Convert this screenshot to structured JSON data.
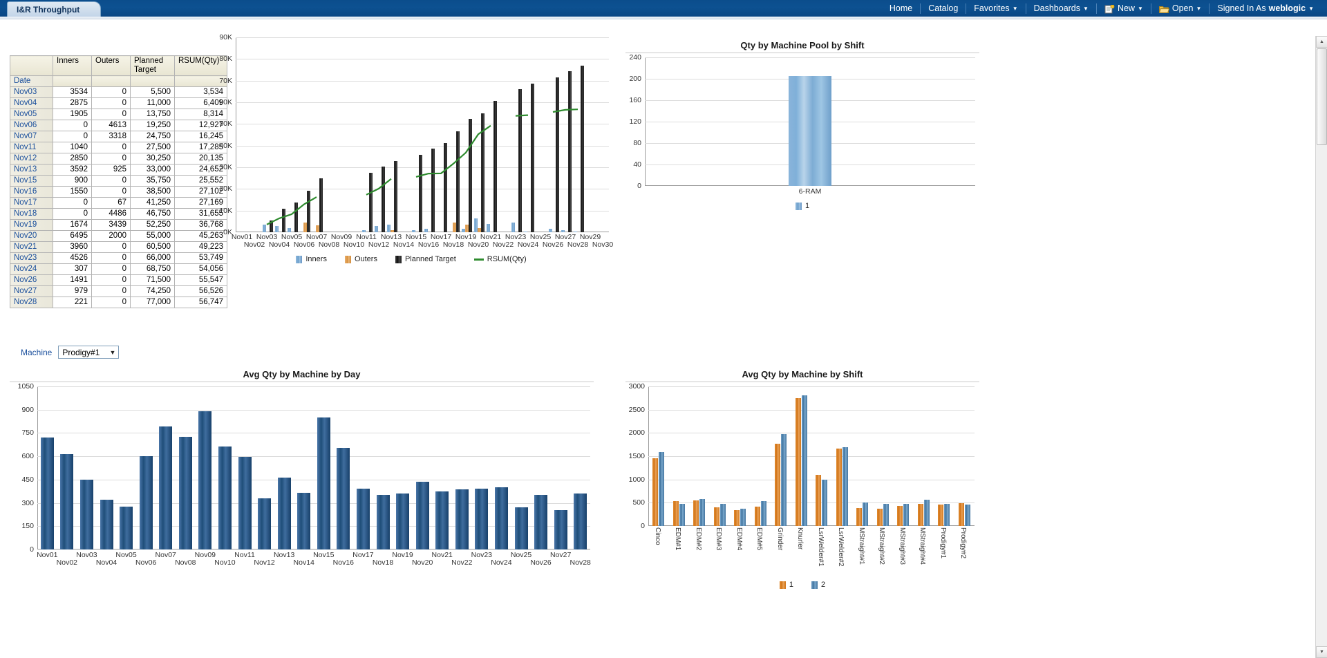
{
  "window": {
    "tab_label": "I&R Throughput"
  },
  "nav": {
    "items": [
      {
        "label": "Home",
        "icon": null,
        "caret": false
      },
      {
        "label": "Catalog",
        "icon": null,
        "caret": false
      },
      {
        "label": "Favorites",
        "icon": null,
        "caret": true
      },
      {
        "label": "Dashboards",
        "icon": null,
        "caret": true
      },
      {
        "label": "New",
        "icon": "new-page-icon",
        "caret": true
      },
      {
        "label": "Open",
        "icon": "folder-open-icon",
        "caret": true
      }
    ],
    "signed_in_label": "Signed In As",
    "user": "weblogic",
    "user_caret": true
  },
  "table": {
    "columns": [
      "",
      "Inners",
      "Outers",
      "Planned Target",
      "RSUM(Qty)"
    ],
    "group_label": "Date",
    "rows": [
      {
        "date": "Nov03",
        "inners": "3534",
        "outers": "0",
        "planned": "5,500",
        "rsum": "3,534"
      },
      {
        "date": "Nov04",
        "inners": "2875",
        "outers": "0",
        "planned": "11,000",
        "rsum": "6,409"
      },
      {
        "date": "Nov05",
        "inners": "1905",
        "outers": "0",
        "planned": "13,750",
        "rsum": "8,314"
      },
      {
        "date": "Nov06",
        "inners": "0",
        "outers": "4613",
        "planned": "19,250",
        "rsum": "12,927"
      },
      {
        "date": "Nov07",
        "inners": "0",
        "outers": "3318",
        "planned": "24,750",
        "rsum": "16,245"
      },
      {
        "date": "Nov11",
        "inners": "1040",
        "outers": "0",
        "planned": "27,500",
        "rsum": "17,285"
      },
      {
        "date": "Nov12",
        "inners": "2850",
        "outers": "0",
        "planned": "30,250",
        "rsum": "20,135"
      },
      {
        "date": "Nov13",
        "inners": "3592",
        "outers": "925",
        "planned": "33,000",
        "rsum": "24,652"
      },
      {
        "date": "Nov15",
        "inners": "900",
        "outers": "0",
        "planned": "35,750",
        "rsum": "25,552"
      },
      {
        "date": "Nov16",
        "inners": "1550",
        "outers": "0",
        "planned": "38,500",
        "rsum": "27,102"
      },
      {
        "date": "Nov17",
        "inners": "0",
        "outers": "67",
        "planned": "41,250",
        "rsum": "27,169"
      },
      {
        "date": "Nov18",
        "inners": "0",
        "outers": "4486",
        "planned": "46,750",
        "rsum": "31,655"
      },
      {
        "date": "Nov19",
        "inners": "1674",
        "outers": "3439",
        "planned": "52,250",
        "rsum": "36,768"
      },
      {
        "date": "Nov20",
        "inners": "6495",
        "outers": "2000",
        "planned": "55,000",
        "rsum": "45,263"
      },
      {
        "date": "Nov21",
        "inners": "3960",
        "outers": "0",
        "planned": "60,500",
        "rsum": "49,223"
      },
      {
        "date": "Nov23",
        "inners": "4526",
        "outers": "0",
        "planned": "66,000",
        "rsum": "53,749"
      },
      {
        "date": "Nov24",
        "inners": "307",
        "outers": "0",
        "planned": "68,750",
        "rsum": "54,056"
      },
      {
        "date": "Nov26",
        "inners": "1491",
        "outers": "0",
        "planned": "71,500",
        "rsum": "55,547"
      },
      {
        "date": "Nov27",
        "inners": "979",
        "outers": "0",
        "planned": "74,250",
        "rsum": "56,526"
      },
      {
        "date": "Nov28",
        "inners": "221",
        "outers": "0",
        "planned": "77,000",
        "rsum": "56,747"
      }
    ]
  },
  "prompt": {
    "label": "Machine",
    "value": "Prodigy#1",
    "options": [
      "Prodigy#1"
    ]
  },
  "chart_data": [
    {
      "id": "throughput",
      "type": "bar",
      "title": "",
      "xlabel": "",
      "ylabel": "",
      "ylim": [
        0,
        90000
      ],
      "ytick_labels": [
        "0K",
        "10K",
        "20K",
        "30K",
        "40K",
        "50K",
        "60K",
        "70K",
        "80K",
        "90K"
      ],
      "yticks": [
        0,
        10000,
        20000,
        30000,
        40000,
        50000,
        60000,
        70000,
        80000,
        90000
      ],
      "grid": true,
      "legend_position": "bottom",
      "categories": [
        "Nov01",
        "Nov02",
        "Nov03",
        "Nov04",
        "Nov05",
        "Nov06",
        "Nov07",
        "Nov08",
        "Nov09",
        "Nov10",
        "Nov11",
        "Nov12",
        "Nov13",
        "Nov14",
        "Nov15",
        "Nov16",
        "Nov17",
        "Nov18",
        "Nov19",
        "Nov20",
        "Nov21",
        "Nov22",
        "Nov23",
        "Nov24",
        "Nov25",
        "Nov26",
        "Nov27",
        "Nov28",
        "Nov29",
        "Nov30"
      ],
      "series": [
        {
          "name": "Inners",
          "color": "#7fb0d9",
          "type": "bar",
          "values": [
            0,
            0,
            3534,
            2875,
            1905,
            0,
            0,
            0,
            0,
            0,
            1040,
            2850,
            3592,
            0,
            900,
            1550,
            0,
            0,
            1674,
            6495,
            3960,
            0,
            4526,
            307,
            0,
            1491,
            979,
            221,
            0,
            0
          ]
        },
        {
          "name": "Outers",
          "color": "#d98c2b",
          "type": "bar",
          "values": [
            0,
            0,
            0,
            0,
            0,
            4613,
            3318,
            0,
            0,
            0,
            0,
            0,
            925,
            0,
            0,
            0,
            67,
            4486,
            3439,
            2000,
            0,
            0,
            0,
            0,
            0,
            0,
            0,
            0,
            0,
            0
          ]
        },
        {
          "name": "Planned Target",
          "color": "#1c1c1c",
          "type": "bar",
          "values": [
            0,
            0,
            5500,
            11000,
            13750,
            19250,
            24750,
            0,
            0,
            0,
            27500,
            30250,
            33000,
            0,
            35750,
            38500,
            41250,
            46750,
            52250,
            55000,
            60500,
            0,
            66000,
            68750,
            0,
            71500,
            74250,
            77000,
            0,
            0
          ]
        },
        {
          "name": "RSUM(Qty)",
          "color": "#2e8b2e",
          "type": "line",
          "values": [
            null,
            null,
            3534,
            6409,
            8314,
            12927,
            16245,
            null,
            null,
            null,
            17285,
            20135,
            24652,
            null,
            25552,
            27102,
            27169,
            31655,
            36768,
            45263,
            49223,
            null,
            53749,
            54056,
            null,
            55547,
            56526,
            56747,
            null,
            null
          ]
        }
      ]
    },
    {
      "id": "qty-machine-pool-shift",
      "type": "bar",
      "title": "Qty by Machine Pool by Shift",
      "xlabel": "",
      "ylabel": "",
      "ylim": [
        0,
        240
      ],
      "yticks": [
        0,
        40,
        80,
        120,
        160,
        200,
        240
      ],
      "grid": true,
      "legend_position": "bottom",
      "categories": [
        "6-RAM"
      ],
      "series": [
        {
          "name": "1",
          "color": "#7fb0d9",
          "values": [
            205
          ]
        }
      ]
    },
    {
      "id": "avg-qty-machine-day",
      "type": "bar",
      "title": "Avg Qty by Machine by Day",
      "xlabel": "",
      "ylabel": "",
      "ylim": [
        0,
        1050
      ],
      "yticks": [
        0,
        150,
        300,
        450,
        600,
        750,
        900,
        1050
      ],
      "grid": true,
      "legend_position": "none",
      "categories": [
        "Nov01",
        "Nov02",
        "Nov03",
        "Nov04",
        "Nov05",
        "Nov06",
        "Nov07",
        "Nov08",
        "Nov09",
        "Nov10",
        "Nov11",
        "Nov12",
        "Nov13",
        "Nov14",
        "Nov15",
        "Nov16",
        "Nov17",
        "Nov18",
        "Nov19",
        "Nov20",
        "Nov21",
        "Nov22",
        "Nov23",
        "Nov24",
        "Nov25",
        "Nov26",
        "Nov27",
        "Nov28"
      ],
      "series": [
        {
          "name": "Avg Qty",
          "color": "#1f4e79",
          "values": [
            720,
            615,
            450,
            320,
            275,
            600,
            790,
            725,
            890,
            665,
            595,
            330,
            465,
            365,
            850,
            655,
            390,
            350,
            360,
            435,
            375,
            385,
            390,
            400,
            270,
            350,
            255,
            360
          ]
        }
      ]
    },
    {
      "id": "avg-qty-machine-shift",
      "type": "bar",
      "title": "Avg Qty by Machine by Shift",
      "xlabel": "",
      "ylabel": "",
      "ylim": [
        0,
        3000
      ],
      "yticks": [
        0,
        500,
        1000,
        1500,
        2000,
        2500,
        3000
      ],
      "grid": true,
      "legend_position": "bottom",
      "categories": [
        "Cinco",
        "EDM#1",
        "EDM#2",
        "EDM#3",
        "EDM#4",
        "EDM#5",
        "Grinder",
        "Knurler",
        "LsrWelder#1",
        "LsrWelder#2",
        "MStraight#1",
        "MStraight#2",
        "MStraight#3",
        "MStraight#4",
        "Prodigy#1",
        "Prodigy#2"
      ],
      "series": [
        {
          "name": "1",
          "color": "#d2761b",
          "values": [
            1455,
            530,
            555,
            395,
            335,
            410,
            1765,
            2755,
            1095,
            1665,
            385,
            365,
            430,
            480,
            460,
            490
          ]
        },
        {
          "name": "2",
          "color": "#42759f",
          "values": [
            1595,
            470,
            575,
            470,
            370,
            540,
            1970,
            2805,
            990,
            1700,
            505,
            475,
            480,
            565,
            480,
            460
          ]
        }
      ]
    }
  ]
}
